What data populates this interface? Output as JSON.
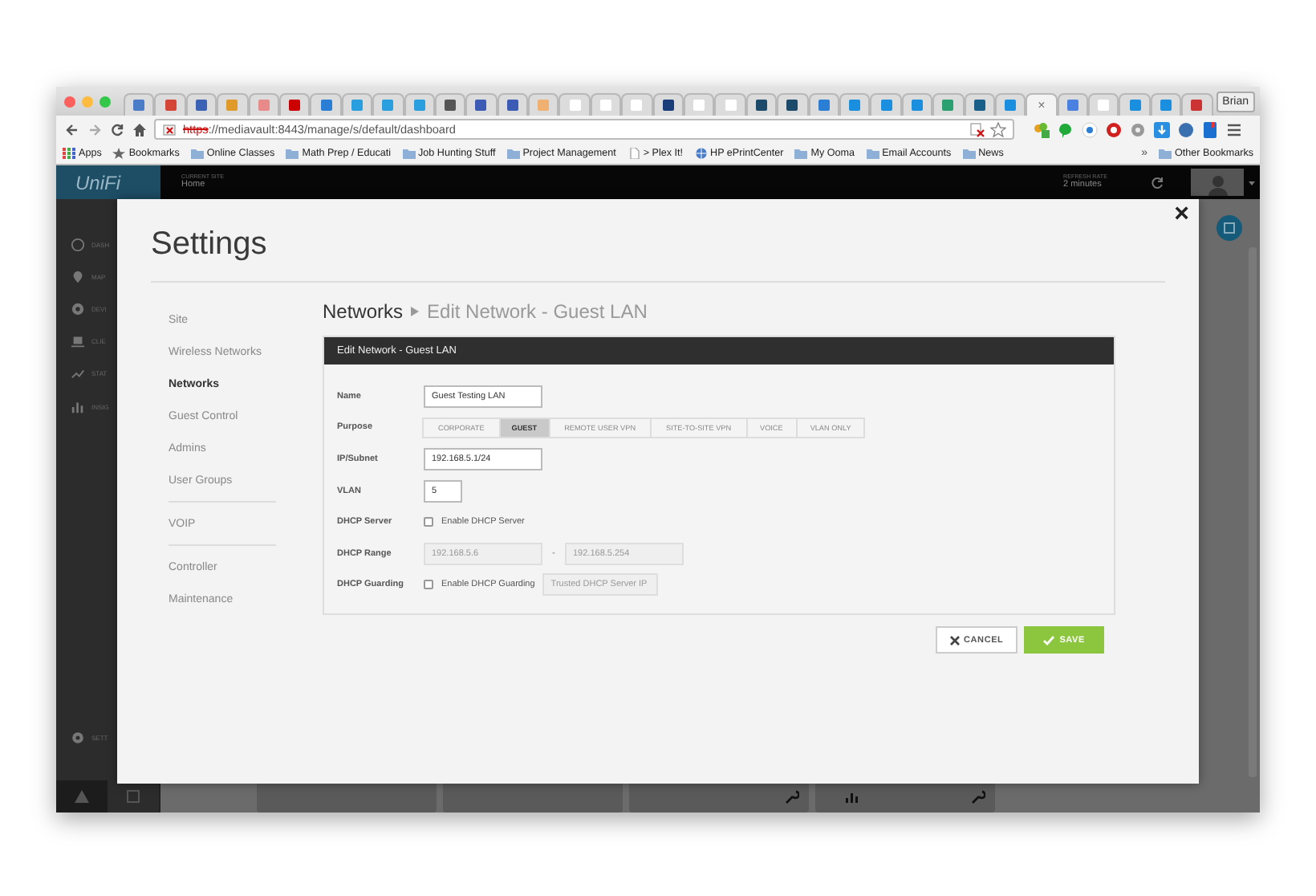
{
  "browser": {
    "tabs": [
      {
        "color": "#4a7cc7",
        "selected": false
      },
      {
        "color": "#d44638",
        "selected": false
      },
      {
        "color": "#3b62b5",
        "selected": false
      },
      {
        "color": "#e09a2a",
        "selected": false
      },
      {
        "color": "#e88a8a",
        "selected": false
      },
      {
        "color": "#cc0000",
        "selected": false
      },
      {
        "color": "#2a7fd4",
        "selected": false
      },
      {
        "color": "#2a9fe0",
        "selected": false
      },
      {
        "color": "#2a9fe0",
        "selected": false
      },
      {
        "color": "#2a9fe0",
        "selected": false
      },
      {
        "color": "#555555",
        "selected": false
      },
      {
        "color": "#3b5bb5",
        "selected": false
      },
      {
        "color": "#3b5bb5",
        "selected": false
      },
      {
        "color": "#f0b070",
        "selected": false
      },
      {
        "color": "#ffffff",
        "selected": false
      },
      {
        "color": "#ffffff",
        "selected": false
      },
      {
        "color": "#ffffff",
        "selected": false
      },
      {
        "color": "#1b3e7a",
        "selected": false
      },
      {
        "color": "#ffffff",
        "selected": false
      },
      {
        "color": "#ffffff",
        "selected": false
      },
      {
        "color": "#1b4a6a",
        "selected": false
      },
      {
        "color": "#1b4a6a",
        "selected": false
      },
      {
        "color": "#2a7fd4",
        "selected": false
      },
      {
        "color": "#1a8fe0",
        "selected": false
      },
      {
        "color": "#1a8fe0",
        "selected": false
      },
      {
        "color": "#1a8fe0",
        "selected": false
      },
      {
        "color": "#2aa070",
        "selected": false
      },
      {
        "color": "#1a5f8a",
        "selected": false
      },
      {
        "color": "#1a8fe0",
        "selected": false
      },
      {
        "selected": true
      },
      {
        "color": "#4a80e0",
        "selected": false
      },
      {
        "color": "#ffffff",
        "selected": false
      },
      {
        "color": "#1a8fe0",
        "selected": false
      },
      {
        "color": "#1a8fe0",
        "selected": false
      },
      {
        "color": "#cc3333",
        "selected": false
      }
    ],
    "tab_close": "×",
    "profile": "Brian",
    "address": {
      "scheme": "https",
      "rest": "://mediavault:8443/manage/s/default/dashboard"
    },
    "bookmarks": [
      {
        "kind": "apps",
        "label": "Apps"
      },
      {
        "kind": "star",
        "label": "Bookmarks"
      },
      {
        "kind": "folder",
        "label": "Online Classes"
      },
      {
        "kind": "folder",
        "label": "Math Prep / Educati"
      },
      {
        "kind": "folder",
        "label": "Job Hunting Stuff"
      },
      {
        "kind": "folder",
        "label": "Project Management"
      },
      {
        "kind": "page",
        "label": "> Plex It!"
      },
      {
        "kind": "globe",
        "label": "HP ePrintCenter"
      },
      {
        "kind": "folder",
        "label": "My Ooma"
      },
      {
        "kind": "folder",
        "label": "Email Accounts"
      },
      {
        "kind": "folder",
        "label": "News"
      }
    ],
    "bookmarks_overflow": "»",
    "other_bookmarks": "Other Bookmarks"
  },
  "app": {
    "logo": "UniFi",
    "current_site": {
      "label": "CURRENT SITE",
      "value": "Home"
    },
    "refresh_rate": {
      "label": "REFRESH RATE",
      "value": "2 minutes"
    },
    "sidebar": [
      {
        "kind": "dashboard",
        "label": "DASH"
      },
      {
        "kind": "map",
        "label": "MAP"
      },
      {
        "kind": "devices",
        "label": "DEVI"
      },
      {
        "kind": "clients",
        "label": "CLIE"
      },
      {
        "kind": "stats",
        "label": "STAT"
      },
      {
        "kind": "insights",
        "label": "INSIG"
      }
    ],
    "settings_label": "SETT"
  },
  "modal": {
    "title": "Settings",
    "close": "×",
    "nav_groups": [
      [
        {
          "label": "Site",
          "selected": false
        },
        {
          "label": "Wireless Networks",
          "selected": false
        },
        {
          "label": "Networks",
          "selected": true
        },
        {
          "label": "Guest Control",
          "selected": false
        },
        {
          "label": "Admins",
          "selected": false
        },
        {
          "label": "User Groups",
          "selected": false
        }
      ],
      [
        {
          "label": "VOIP",
          "selected": false
        }
      ],
      [
        {
          "label": "Controller",
          "selected": false
        },
        {
          "label": "Maintenance",
          "selected": false
        }
      ]
    ],
    "breadcrumb": {
      "parent": "Networks",
      "current": "Edit Network - Guest LAN"
    },
    "panel_title": "Edit Network - Guest LAN",
    "rows": [
      {
        "kind": "text",
        "label": "Name",
        "value": "Guest Testing LAN"
      },
      {
        "kind": "segmented",
        "label": "Purpose",
        "options": [
          {
            "label": "CORPORATE",
            "selected": false
          },
          {
            "label": "GUEST",
            "selected": true
          },
          {
            "label": "REMOTE USER VPN",
            "selected": false
          },
          {
            "label": "SITE-TO-SITE VPN",
            "selected": false
          },
          {
            "label": "VOICE",
            "selected": false
          },
          {
            "label": "VLAN ONLY",
            "selected": false
          }
        ]
      },
      {
        "kind": "text",
        "label": "IP/Subnet",
        "value": "192.168.5.1/24"
      },
      {
        "kind": "number",
        "label": "VLAN",
        "value": "5"
      },
      {
        "kind": "checkbox",
        "label": "DHCP Server",
        "text": "Enable DHCP Server",
        "checked": false
      },
      {
        "kind": "range",
        "label": "DHCP Range",
        "start": "192.168.5.6",
        "separator": "-",
        "end": "192.168.5.254",
        "disabled": true
      },
      {
        "kind": "checkbox_field",
        "label": "DHCP Guarding",
        "text": "Enable DHCP Guarding",
        "checked": false,
        "placeholder": "Trusted DHCP Server IP",
        "disabled": true
      }
    ],
    "buttons": [
      {
        "kind": "cancel",
        "label": "CANCEL"
      },
      {
        "kind": "save",
        "label": "SAVE"
      }
    ]
  }
}
